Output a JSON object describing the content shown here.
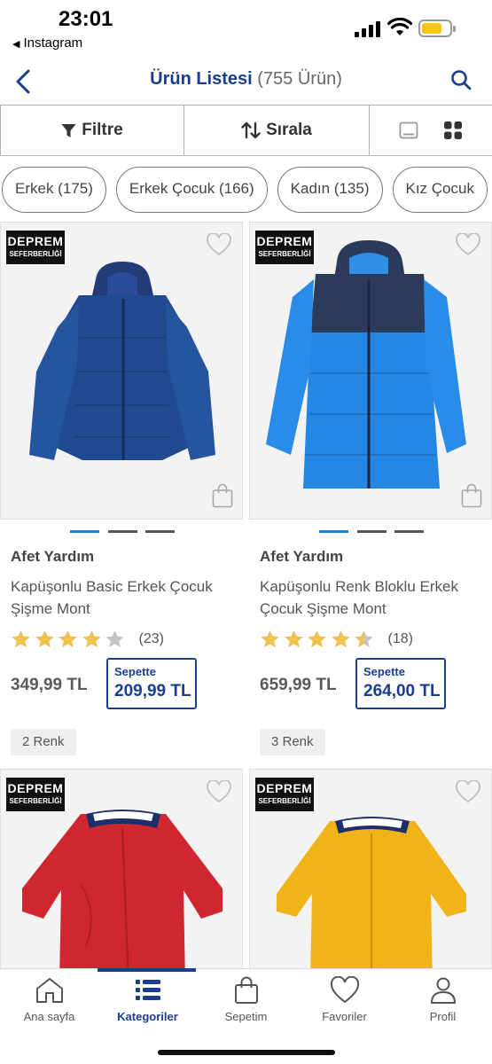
{
  "status_bar": {
    "time": "23:01",
    "back_app": "Instagram",
    "battery_fraction": 0.72,
    "battery_color": "#f5c518"
  },
  "header": {
    "title": "Ürün Listesi",
    "count": "(755 Ürün)",
    "back_icon": "chevron-left-icon",
    "search_icon": "search-icon"
  },
  "toolbar": {
    "filter_label": "Filtre",
    "sort_label": "Sırala",
    "filter_icon": "funnel-icon",
    "sort_icon": "sort-arrows-icon",
    "view_list_icon": "single-view-icon",
    "view_grid_icon": "grid-view-icon"
  },
  "chips": [
    {
      "label": "Erkek (175)"
    },
    {
      "label": "Erkek Çocuk (166)"
    },
    {
      "label": "Kadın (135)"
    },
    {
      "label": "Kız Çocuk"
    }
  ],
  "badge": {
    "line1": "DEPREM",
    "line2": "SEFERBERLİĞİ"
  },
  "products": [
    {
      "brand": "Afet Yardım",
      "name": "Kapüşonlu Basic Erkek Çocuk Şişme Mont",
      "rating": 4,
      "rating_count": "(23)",
      "price": "349,99 TL",
      "basket_label": "Sepette",
      "basket_price": "209,99 TL",
      "colors": "2 Renk"
    },
    {
      "brand": "Afet Yardım",
      "name": "Kapüşonlu Renk Bloklu Erkek Çocuk Şişme Mont",
      "rating": 4.5,
      "rating_count": "(18)",
      "price": "659,99 TL",
      "basket_label": "Sepette",
      "basket_price": "264,00 TL",
      "colors": "3 Renk"
    },
    {
      "image": "red-raincoat"
    },
    {
      "image": "yellow-raincoat"
    }
  ],
  "bottom_nav": [
    {
      "label": "Ana sayfa",
      "icon": "home-icon"
    },
    {
      "label": "Kategoriler",
      "icon": "list-icon",
      "active": true
    },
    {
      "label": "Sepetim",
      "icon": "shopping-bag-icon"
    },
    {
      "label": "Favoriler",
      "icon": "heart-icon"
    },
    {
      "label": "Profil",
      "icon": "user-icon"
    }
  ],
  "colors": {
    "brand_blue": "#1a3d8f",
    "star_gold": "#f2c14e",
    "star_empty": "#c4c4c4",
    "dot_active": "#1b7fd4"
  }
}
